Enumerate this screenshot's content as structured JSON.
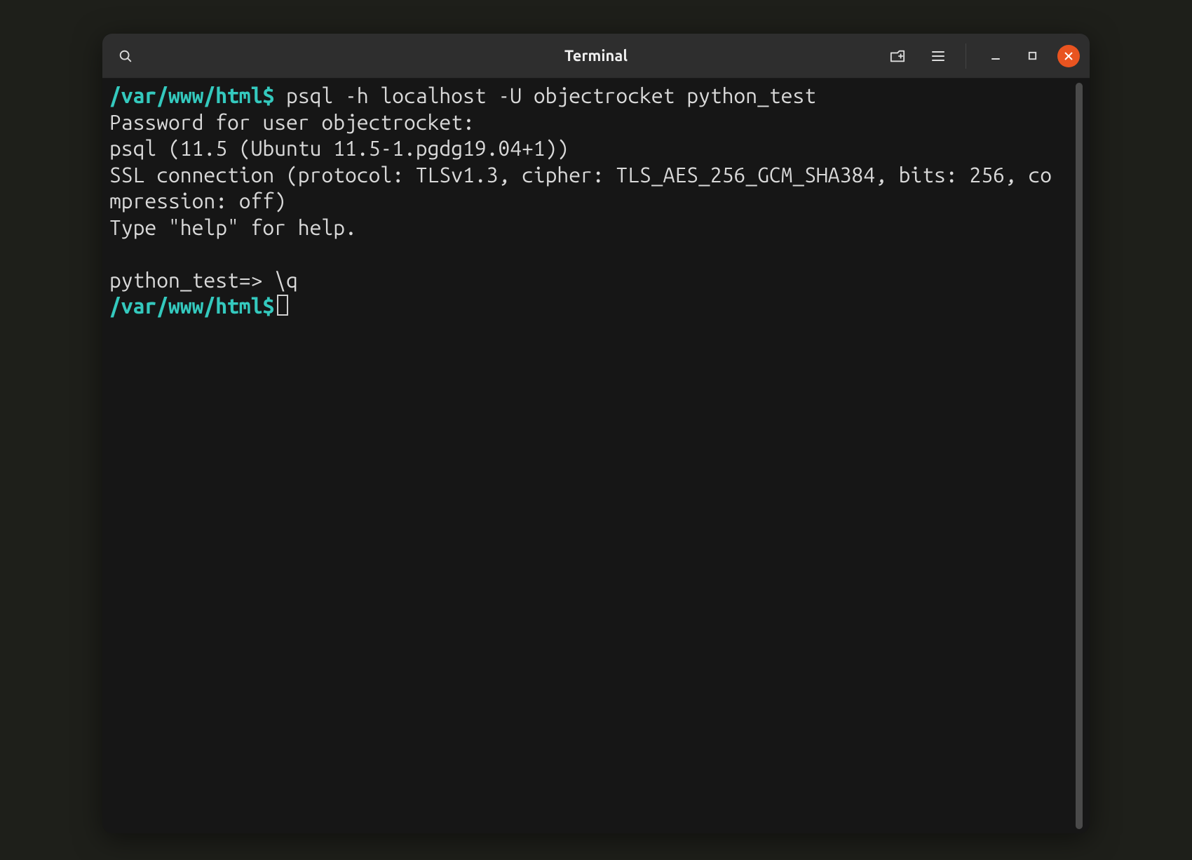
{
  "window": {
    "title": "Terminal"
  },
  "icons": {
    "search": "search-icon",
    "new_tab": "new-tab-icon",
    "menu": "hamburger-menu-icon",
    "minimize": "minimize-icon",
    "maximize": "maximize-icon",
    "close": "close-icon"
  },
  "colors": {
    "prompt": "#34c9be",
    "text": "#d9d9d9",
    "bg": "#161616",
    "titlebar_bg": "#2e2e2e",
    "close_btn": "#e95420"
  },
  "terminal": {
    "lines": [
      {
        "type": "cmd",
        "prompt_path": "/var/www/html",
        "prompt_symbol": "$",
        "command": " psql -h localhost -U objectrocket python_test"
      },
      {
        "type": "out",
        "text": "Password for user objectrocket:"
      },
      {
        "type": "out",
        "text": "psql (11.5 (Ubuntu 11.5-1.pgdg19.04+1))"
      },
      {
        "type": "out",
        "text": "SSL connection (protocol: TLSv1.3, cipher: TLS_AES_256_GCM_SHA384, bits: 256, compression: off)"
      },
      {
        "type": "out",
        "text": "Type \"help\" for help."
      },
      {
        "type": "blank"
      },
      {
        "type": "out",
        "text": "python_test=> \\q"
      },
      {
        "type": "cmd",
        "prompt_path": "/var/www/html",
        "prompt_symbol": "$",
        "command": "",
        "cursor": true
      }
    ]
  }
}
